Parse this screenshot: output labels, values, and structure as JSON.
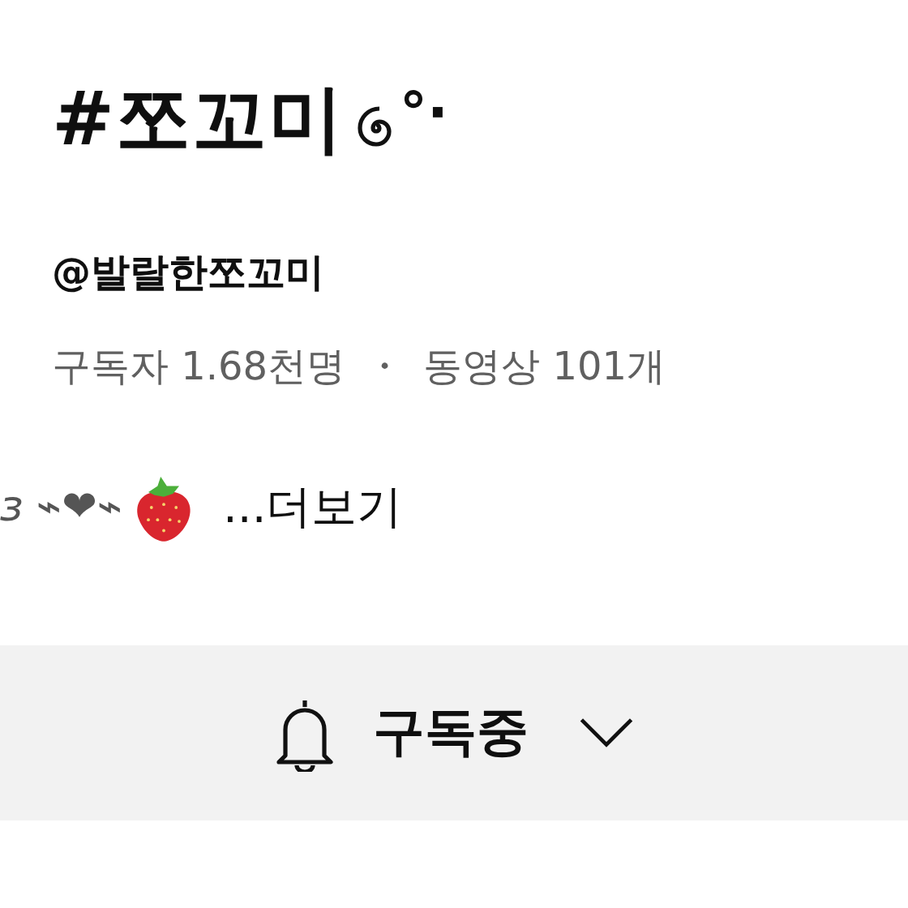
{
  "channel": {
    "title": "#쪼꼬미",
    "title_suffix": "°·",
    "handle": "@발랄한쪼꼬미",
    "subscribers": "구독자 1.68천명",
    "separator": "・",
    "videos": "동영상 101개",
    "description": "ɜ ⌁❤⌁",
    "more": "...더보기"
  },
  "subscribe_button": {
    "label": "구독중",
    "subscribed": true
  }
}
